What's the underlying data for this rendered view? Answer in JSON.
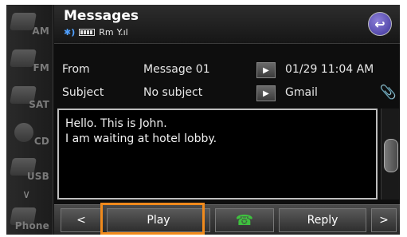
{
  "sidebar": {
    "items": [
      {
        "label": "AM",
        "icon": "radio-am-icon"
      },
      {
        "label": "FM",
        "icon": "radio-fm-icon"
      },
      {
        "label": "SAT",
        "icon": "satellite-icon"
      },
      {
        "label": "CD",
        "icon": "cd-icon"
      },
      {
        "label": "USB",
        "icon": "usb-icon"
      },
      {
        "label": "Phone",
        "icon": "phone-icon"
      }
    ],
    "more_icon": "chevron-down-icon",
    "more_glyph": "∨"
  },
  "header": {
    "title": "Messages",
    "status": {
      "bluetooth": "✱)",
      "battery": "",
      "mode": "Rm",
      "signal": "Y.ıl"
    },
    "back_icon": "back-arrow-icon",
    "back_glyph": "↩"
  },
  "message": {
    "from_label": "From",
    "from_value": "Message 01",
    "datetime": "01/29  11:04 AM",
    "subject_label": "Subject",
    "subject_value": "No subject",
    "account": "Gmail",
    "body_lines": [
      "Hello. This is John.",
      "I am waiting at hotel lobby."
    ],
    "more_glyph": "▶"
  },
  "toolbar": {
    "prev_glyph": "<",
    "play_label": "Play",
    "call_glyph": "☎",
    "reply_label": "Reply",
    "next_glyph": ">"
  },
  "colors": {
    "highlight": "#f08a1c",
    "accent_call": "#3fc23f",
    "back_button": "#4b3fb0"
  }
}
